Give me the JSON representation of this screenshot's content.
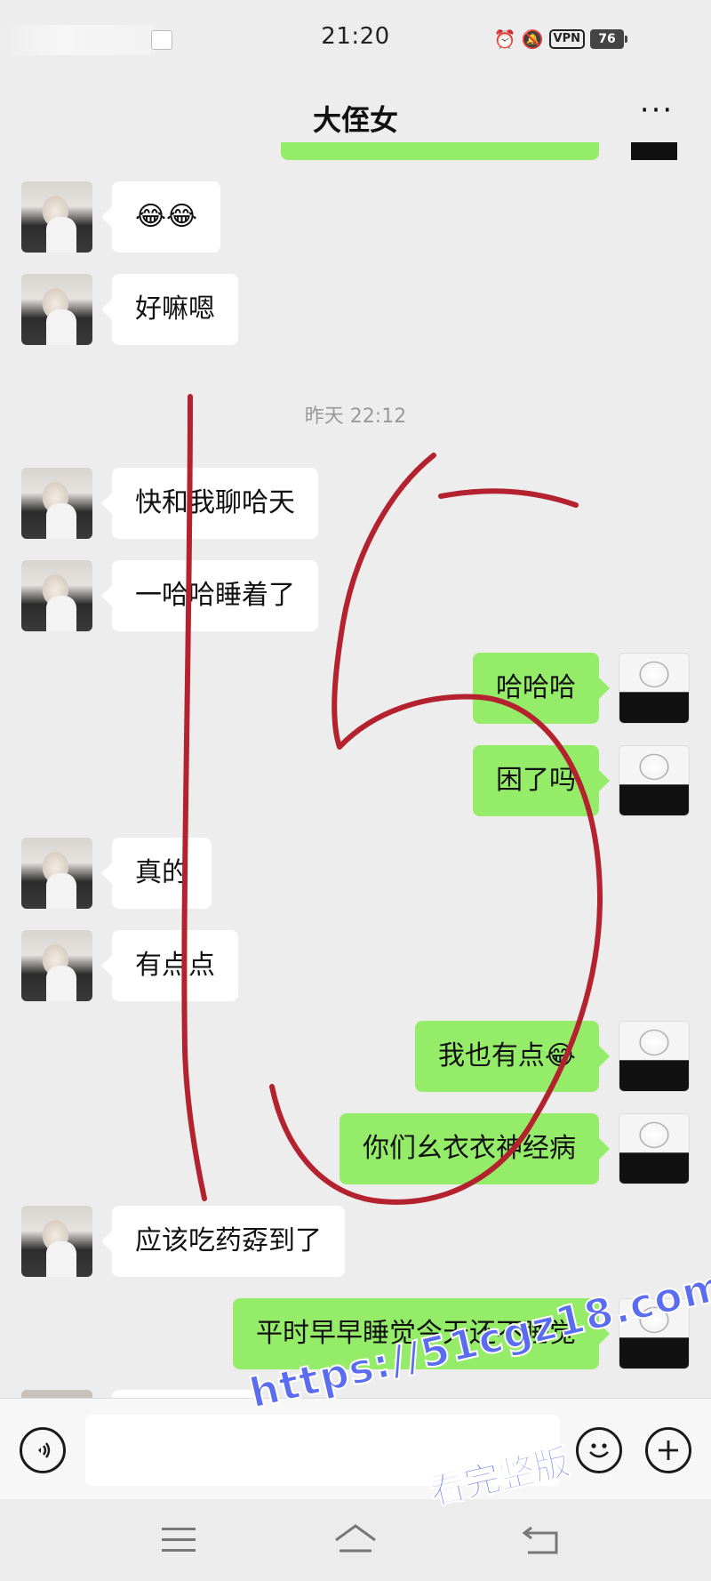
{
  "status_bar": {
    "time": "21:20",
    "vpn_label": "VPN",
    "battery": "76",
    "icons": [
      "alarm-icon",
      "mute-bell-icon",
      "vpn-icon",
      "battery-icon"
    ]
  },
  "header": {
    "title": "大侄女",
    "more_label": "···"
  },
  "timestamp": "昨天 22:12",
  "messages": [
    {
      "from": "other",
      "text": "😂😂"
    },
    {
      "from": "other",
      "text": "好嘛嗯"
    },
    {
      "from": "other",
      "text": "快和我聊哈天"
    },
    {
      "from": "other",
      "text": "一哈哈睡着了"
    },
    {
      "from": "me",
      "text": "哈哈哈"
    },
    {
      "from": "me",
      "text": "困了吗"
    },
    {
      "from": "other",
      "text": "真的"
    },
    {
      "from": "other",
      "text": "有点点"
    },
    {
      "from": "me",
      "text": "我也有点😂"
    },
    {
      "from": "me",
      "text": "你们幺衣衣神经病"
    },
    {
      "from": "other",
      "text": "应该吃药孬到了"
    },
    {
      "from": "me",
      "text": "平时早早睡觉今天还不睡觉"
    }
  ],
  "input_bar": {
    "voice_icon": "voice-icon",
    "emoji_icon": "emoji-icon",
    "plus_icon": "plus-icon",
    "message_value": ""
  },
  "nav_bar": {
    "icons": [
      "menu-icon",
      "home-icon",
      "back-icon"
    ]
  },
  "annotation": {
    "handwritten_mark": "15",
    "color": "#b3222e"
  },
  "watermark": {
    "url": "https://51cgz18.com",
    "caption": "看完整版",
    "color": "#5a6cf0"
  },
  "colors": {
    "sent_bubble": "#95ec69",
    "received_bubble": "#ffffff",
    "background": "#ededed"
  }
}
